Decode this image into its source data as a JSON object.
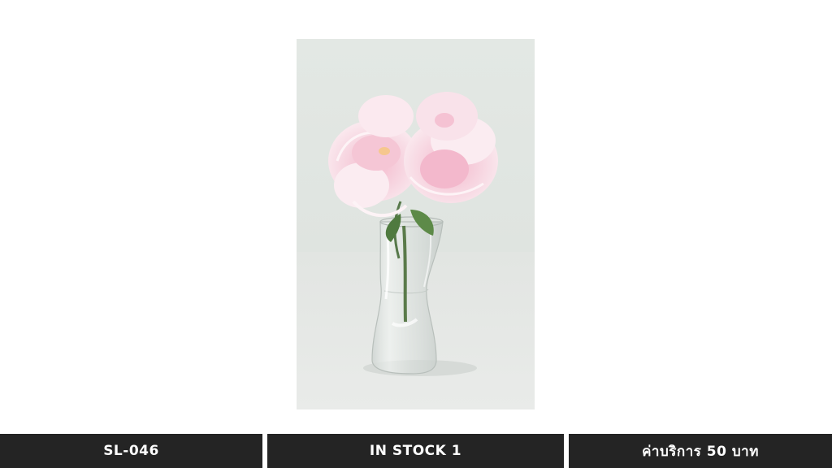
{
  "product": {
    "image_subject": "pink-peony-bouquet-in-glass-vase",
    "sku": "SL-046",
    "stock": "IN STOCK 1",
    "price": "ค่าบริการ 50 บาท"
  },
  "colors": {
    "bar_background": "#242424",
    "bar_text": "#ffffff",
    "page_background": "#ffffff",
    "photo_background": "#e6e9e6",
    "petal_pink": "#f3cbd8"
  }
}
